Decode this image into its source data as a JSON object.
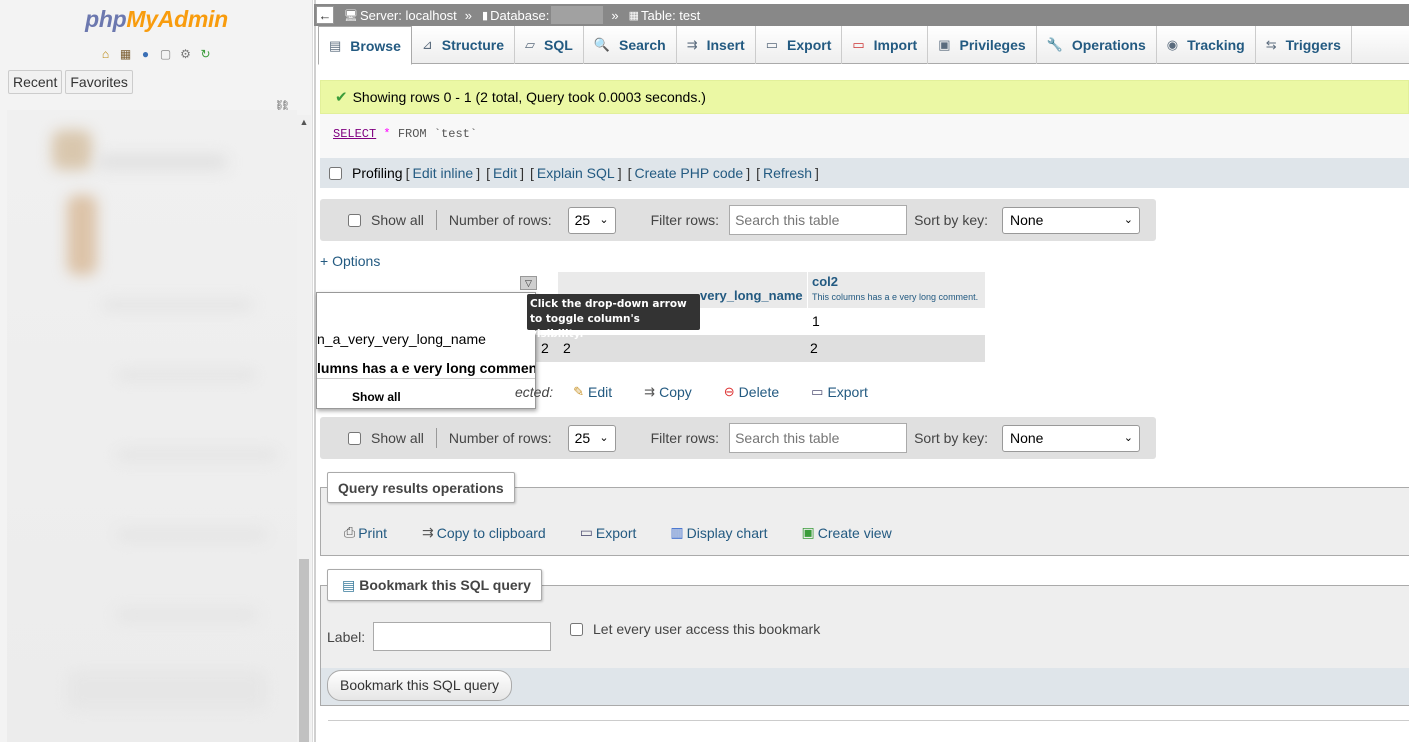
{
  "nav": {
    "logo_php": "php",
    "logo_myadmin": "MyAdmin",
    "icons": [
      "home-icon",
      "database-icon",
      "info-icon",
      "documentation-icon",
      "settings-icon",
      "reload-icon"
    ],
    "recent": "Recent",
    "favorites": "Favorites"
  },
  "breadcrumb": {
    "collapse": "←",
    "server": "Server: localhost",
    "database": "Database:",
    "table": "Table: test",
    "sep": "»"
  },
  "tabs": [
    {
      "label": "Browse",
      "icon": "browse-icon"
    },
    {
      "label": "Structure",
      "icon": "structure-icon"
    },
    {
      "label": "SQL",
      "icon": "sql-icon"
    },
    {
      "label": "Search",
      "icon": "search-icon"
    },
    {
      "label": "Insert",
      "icon": "insert-icon"
    },
    {
      "label": "Export",
      "icon": "export-icon"
    },
    {
      "label": "Import",
      "icon": "import-icon"
    },
    {
      "label": "Privileges",
      "icon": "privileges-icon"
    },
    {
      "label": "Operations",
      "icon": "operations-icon"
    },
    {
      "label": "Tracking",
      "icon": "tracking-icon"
    },
    {
      "label": "Triggers",
      "icon": "triggers-icon"
    }
  ],
  "success_message": "Showing rows 0 - 1 (2 total, Query took 0.0003 seconds.)",
  "sql": {
    "select": "SELECT",
    "star": "*",
    "from": "FROM",
    "table": "`test`"
  },
  "profiling": {
    "label": "Profiling",
    "links": [
      "Edit inline",
      "Edit",
      "Explain SQL",
      "Create PHP code",
      "Refresh"
    ]
  },
  "navbar": {
    "show_all": "Show all",
    "number_of_rows": "Number of rows:",
    "rows_value": "25",
    "filter_rows": "Filter rows:",
    "filter_placeholder": "Search this table",
    "sort_by_key": "Sort by key:",
    "sort_value": "None"
  },
  "options_link": "+ Options",
  "table": {
    "col1_visible_text": "very_long_name",
    "col2_name": "col2",
    "col2_comment": "This columns has a e very long comment.",
    "rows": [
      {
        "col1": "",
        "col2": "1"
      },
      {
        "col1_a": "2",
        "col1_b": "2",
        "col2": "2"
      }
    ]
  },
  "tooltip": {
    "line1": "Click the drop-down arrow",
    "line2": "to toggle column's visibility."
  },
  "column_menu": {
    "item1": "n_a_very_very_long_name",
    "item2": "lumns has a e very long comment.",
    "show_all": "Show all"
  },
  "with_selected": {
    "label": "ected:",
    "actions": [
      {
        "label": "Edit",
        "icon": "pencil-icon"
      },
      {
        "label": "Copy",
        "icon": "copy-icon"
      },
      {
        "label": "Delete",
        "icon": "delete-icon"
      },
      {
        "label": "Export",
        "icon": "export-icon"
      }
    ]
  },
  "query_ops": {
    "legend": "Query results operations",
    "items": [
      {
        "label": "Print",
        "icon": "print-icon"
      },
      {
        "label": "Copy to clipboard",
        "icon": "clipboard-icon"
      },
      {
        "label": "Export",
        "icon": "export-icon"
      },
      {
        "label": "Display chart",
        "icon": "chart-icon"
      },
      {
        "label": "Create view",
        "icon": "view-icon"
      }
    ]
  },
  "bookmark": {
    "legend": "Bookmark this SQL query",
    "label": "Label:",
    "checkbox": "Let every user access this bookmark",
    "button": "Bookmark this SQL query"
  }
}
